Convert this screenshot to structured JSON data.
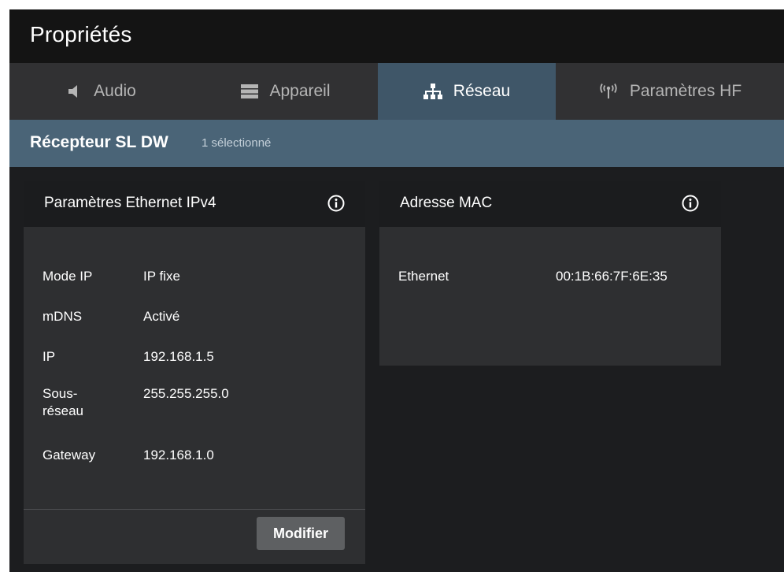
{
  "window": {
    "title": "Propriétés"
  },
  "tabs": [
    {
      "label": "Audio",
      "icon": "speaker-icon",
      "active": false
    },
    {
      "label": "Appareil",
      "icon": "device-icon",
      "active": false
    },
    {
      "label": "Réseau",
      "icon": "network-icon",
      "active": true
    },
    {
      "label": "Paramètres HF",
      "icon": "antenna-icon",
      "active": false
    }
  ],
  "device": {
    "name": "Récepteur SL DW",
    "selection": "1 sélectionné"
  },
  "ethernet_card": {
    "title": "Paramètres Ethernet IPv4",
    "rows": [
      {
        "label": "Mode IP",
        "value": "IP fixe"
      },
      {
        "label": "mDNS",
        "value": "Activé"
      },
      {
        "label": "IP",
        "value": "192.168.1.5"
      },
      {
        "label": "Sous-\nréseau",
        "value": "255.255.255.0"
      },
      {
        "label": "Gateway",
        "value": "192.168.1.0"
      }
    ],
    "edit_label": "Modifier"
  },
  "mac_card": {
    "title": "Adresse MAC",
    "rows": [
      {
        "label": "Ethernet",
        "value": "00:1B:66:7F:6E:35"
      }
    ]
  },
  "colors": {
    "title_bar": "#141414",
    "tab_bar": "#313133",
    "tab_active": "#3f5668",
    "device_bar": "#4a6477",
    "card_body": "#2e2f31",
    "card_header": "#1b1c1e",
    "button": "#5e6062"
  }
}
